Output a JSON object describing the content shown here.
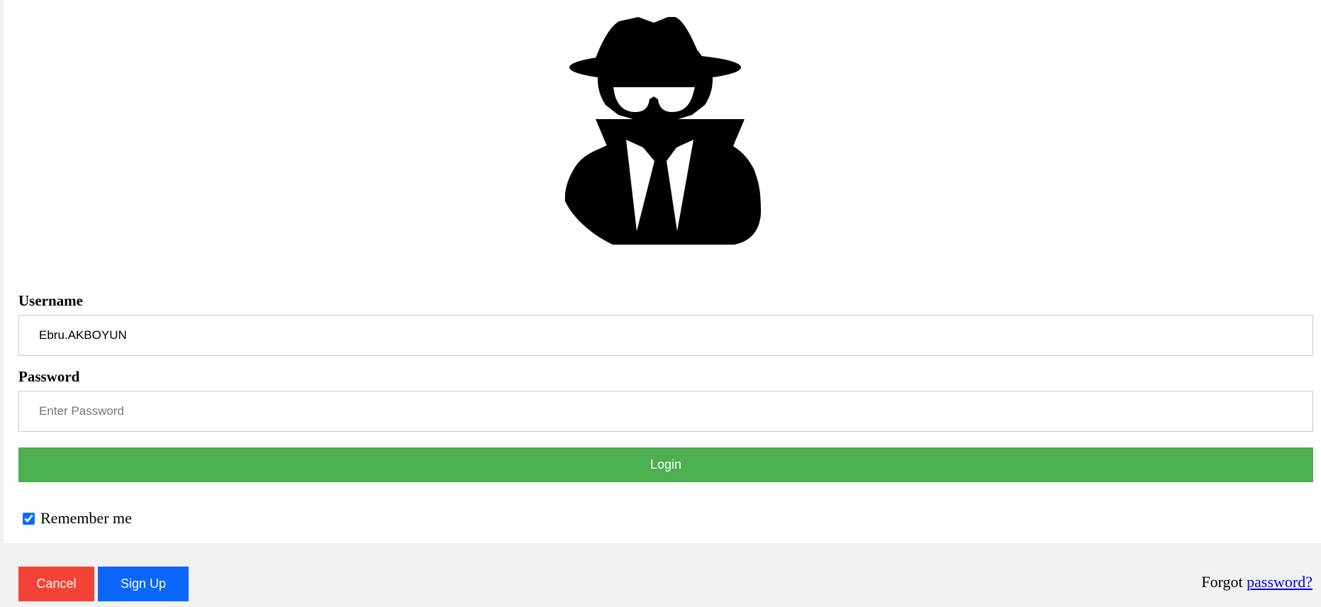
{
  "avatar": {
    "icon": "spy-agent-icon"
  },
  "form": {
    "username_label": "Username",
    "username_value": "Ebru.AKBOYUN",
    "password_label": "Password",
    "password_placeholder": "Enter Password",
    "login_label": "Login",
    "remember_label": "Remember me",
    "remember_checked": true
  },
  "footer": {
    "cancel_label": "Cancel",
    "signup_label": "Sign Up",
    "forgot_prefix": "Forgot",
    "forgot_link": "password?"
  },
  "colors": {
    "login": "#4caf50",
    "cancel": "#f44336",
    "signup": "#0b66fd",
    "link": "#0000ee",
    "footer_bg": "#f1f1f1"
  }
}
